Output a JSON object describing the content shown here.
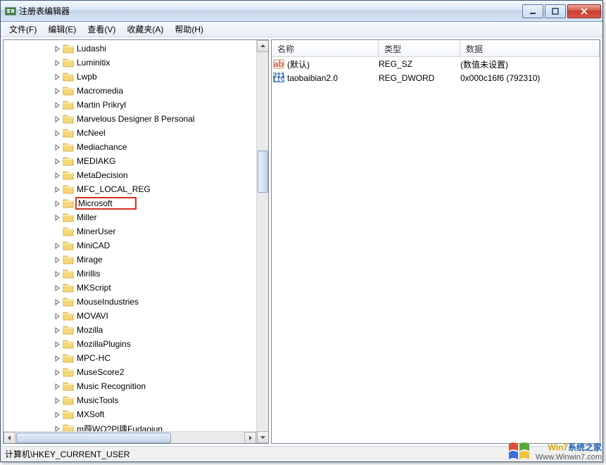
{
  "window": {
    "title": "注册表编辑器"
  },
  "menu": {
    "file": "文件(F)",
    "edit": "编辑(E)",
    "view": "查看(V)",
    "favorites": "收藏夹(A)",
    "help": "帮助(H)"
  },
  "tree": {
    "items": [
      {
        "label": "Ludashi",
        "expander": true
      },
      {
        "label": "Luminitix",
        "expander": true
      },
      {
        "label": "Lwpb",
        "expander": true
      },
      {
        "label": "Macromedia",
        "expander": true
      },
      {
        "label": "Martin Prikryl",
        "expander": true
      },
      {
        "label": "Marvelous Designer 8 Personal",
        "expander": true
      },
      {
        "label": "McNeel",
        "expander": true
      },
      {
        "label": "Mediachance",
        "expander": true
      },
      {
        "label": "MEDIAKG",
        "expander": true
      },
      {
        "label": "MetaDecision",
        "expander": true
      },
      {
        "label": "MFC_LOCAL_REG",
        "expander": true
      },
      {
        "label": "Microsoft",
        "expander": true,
        "highlight": true
      },
      {
        "label": "Miller",
        "expander": true
      },
      {
        "label": "MinerUser",
        "expander": false
      },
      {
        "label": "MiniCAD",
        "expander": true
      },
      {
        "label": "Mirage",
        "expander": true
      },
      {
        "label": "Mirillis",
        "expander": true
      },
      {
        "label": "MKScript",
        "expander": true
      },
      {
        "label": "MouseIndustries",
        "expander": true
      },
      {
        "label": "MOVAVI",
        "expander": true
      },
      {
        "label": "Mozilla",
        "expander": true
      },
      {
        "label": "MozillaPlugins",
        "expander": true
      },
      {
        "label": "MPC-HC",
        "expander": true
      },
      {
        "label": "MuseScore2",
        "expander": true
      },
      {
        "label": "Music Recognition",
        "expander": true
      },
      {
        "label": "MusicTools",
        "expander": true
      },
      {
        "label": "MXSoft",
        "expander": true
      },
      {
        "label": "m葭WQ?Pl瑀Fudaojun",
        "expander": true
      }
    ]
  },
  "values": {
    "columns": {
      "name": "名称",
      "type": "类型",
      "data": "数据"
    },
    "rows": [
      {
        "icon": "string",
        "name": "(默认)",
        "type": "REG_SZ",
        "data": "(数值未设置)"
      },
      {
        "icon": "binary",
        "name": "taobaibian2.0",
        "type": "REG_DWORD",
        "data": "0x000c16f6 (792310)"
      }
    ]
  },
  "status": {
    "path": "计算机\\HKEY_CURRENT_USER"
  },
  "watermark": {
    "line1a": "Win7",
    "line1b": "系统之家",
    "line2": "Www.Winwin7.com"
  }
}
